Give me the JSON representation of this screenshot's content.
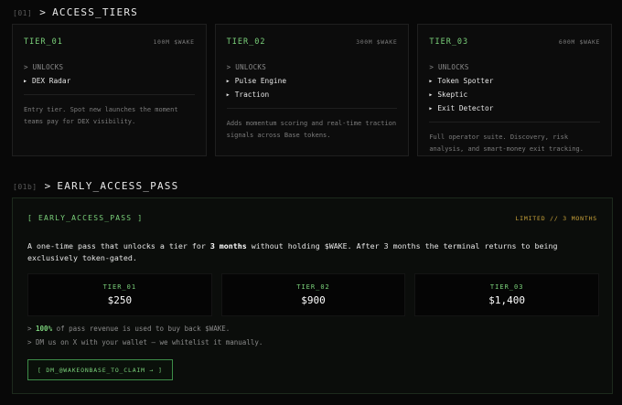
{
  "access": {
    "tag": "[01]",
    "prompt": ">",
    "title": "ACCESS_TIERS",
    "unlocks_label": "> UNLOCKS",
    "tiers": [
      {
        "name": "TIER_01",
        "price": "100M $WAKE",
        "features": [
          "DEX Radar"
        ],
        "desc": "Entry tier. Spot new launches the moment teams pay for DEX visibility."
      },
      {
        "name": "TIER_02",
        "price": "300M $WAKE",
        "features": [
          "Pulse Engine",
          "Traction"
        ],
        "desc": "Adds momentum scoring and real-time traction signals across Base tokens."
      },
      {
        "name": "TIER_03",
        "price": "600M $WAKE",
        "features": [
          "Token Spotter",
          "Skeptic",
          "Exit Detector"
        ],
        "desc": "Full operator suite. Discovery, risk analysis, and smart-money exit tracking."
      }
    ]
  },
  "early": {
    "tag": "[01b]",
    "prompt": ">",
    "title": "EARLY_ACCESS_PASS",
    "label": "[ EARLY_ACCESS_PASS ]",
    "limit": "LIMITED // 3 MONTHS",
    "copy": {
      "pre": "A one-time pass that unlocks a tier for ",
      "bold": "3 months",
      "post": " without holding $WAKE. After 3 months the terminal returns to being exclusively token-gated."
    },
    "prices": [
      {
        "tier": "TIER_01",
        "value": "$250"
      },
      {
        "tier": "TIER_02",
        "value": "$900"
      },
      {
        "tier": "TIER_03",
        "value": "$1,400"
      }
    ],
    "note1": {
      "prefix": "> ",
      "highlight": "100%",
      "rest": " of pass revenue is used to buy back $WAKE."
    },
    "note2": "> DM us on X with your wallet — we whitelist it manually.",
    "cta_label": "[ DM_@WAKEONBASE_TO_CLAIM → ]"
  },
  "colors": {
    "accent": "#7ad07a",
    "warning": "#c9a23a",
    "background": "#080808"
  }
}
